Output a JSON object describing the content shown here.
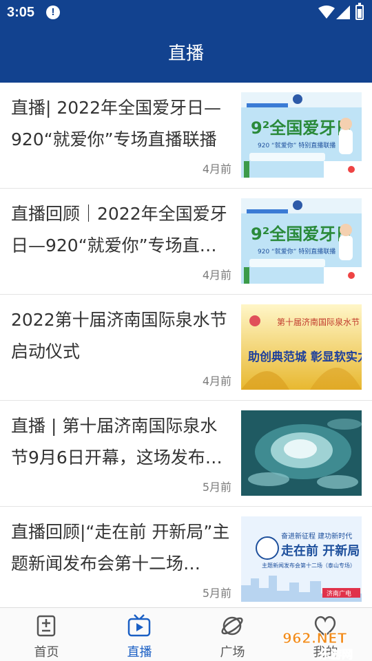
{
  "status_bar": {
    "time": "3:05"
  },
  "header": {
    "title": "直播"
  },
  "articles": [
    {
      "title": "直播| 2022年全国爱牙日—920“就爱你”专场直播联播",
      "time": "4月前",
      "thumb": "dental"
    },
    {
      "title": "直播回顾｜2022年全国爱牙日—920“就爱你”专场直…",
      "time": "4月前",
      "thumb": "dental"
    },
    {
      "title": "2022第十届济南国际泉水节启动仪式",
      "time": "4月前",
      "thumb": "spring-festival"
    },
    {
      "title": "直播 | 第十届济南国际泉水节9月6日开幕，这场发布…",
      "time": "5月前",
      "thumb": "spring-water"
    },
    {
      "title": "直播回顾|“走在前 开新局”主题新闻发布会第十二场…",
      "time": "5月前",
      "thumb": "press-conference"
    }
  ],
  "thumbnails": {
    "dental": {
      "big_text": "9²全国爱牙日",
      "sub_text": "920 “就爱你” 特别直播联播"
    },
    "spring_festival": {
      "top_text": "第十届济南国际泉水节",
      "main_text": "助创典范城 彰显软实力"
    },
    "press_conference": {
      "line1": "奋进新征程 建功新时代",
      "line2": "走在前 开新局",
      "line3": "主题新闻发布会第十二场（泰山专场）",
      "badge": "济南广电"
    }
  },
  "tabs": [
    {
      "label": "首页",
      "icon": "home-document-icon",
      "active": false
    },
    {
      "label": "直播",
      "icon": "tv-play-icon",
      "active": true
    },
    {
      "label": "广场",
      "icon": "planet-icon",
      "active": false
    },
    {
      "label": "我的",
      "icon": "profile-icon",
      "active": false
    }
  ],
  "watermark": {
    "top": "962.NET",
    "bottom": "乐游网"
  },
  "colors": {
    "header_bg": "#12428f",
    "active_tab": "#1a5fc4",
    "text": "#333333",
    "meta": "#7a7a7a"
  }
}
